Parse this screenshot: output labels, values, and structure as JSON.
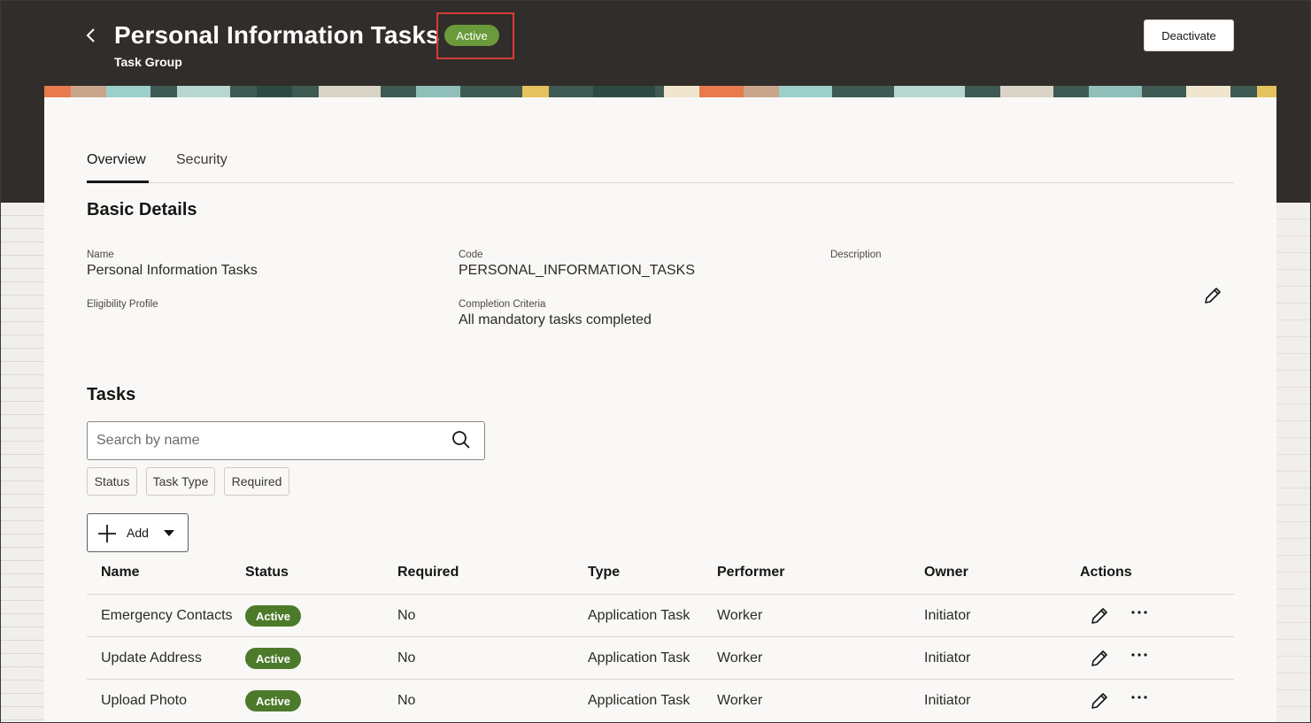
{
  "header": {
    "title": "Personal Information Tasks",
    "subtitle": "Task Group",
    "status_badge": "Active",
    "deactivate_label": "Deactivate"
  },
  "tabs": [
    {
      "label": "Overview",
      "active": true
    },
    {
      "label": "Security",
      "active": false
    }
  ],
  "basic_details": {
    "title": "Basic Details",
    "name_label": "Name",
    "name_value": "Personal Information Tasks",
    "code_label": "Code",
    "code_value": "PERSONAL_INFORMATION_TASKS",
    "description_label": "Description",
    "eligibility_label": "Eligibility Profile",
    "completion_label": "Completion Criteria",
    "completion_value": "All mandatory tasks completed"
  },
  "tasks": {
    "title": "Tasks",
    "search_placeholder": "Search by name",
    "filters": [
      "Status",
      "Task Type",
      "Required"
    ],
    "add_label": "Add",
    "columns": [
      "Name",
      "Status",
      "Required",
      "Type",
      "Performer",
      "Owner",
      "Actions"
    ],
    "rows": [
      {
        "name": "Emergency Contacts",
        "status": "Active",
        "required": "No",
        "type": "Application Task",
        "performer": "Worker",
        "owner": "Initiator"
      },
      {
        "name": "Update Address",
        "status": "Active",
        "required": "No",
        "type": "Application Task",
        "performer": "Worker",
        "owner": "Initiator"
      },
      {
        "name": "Upload Photo",
        "status": "Active",
        "required": "No",
        "type": "Application Task",
        "performer": "Worker",
        "owner": "Initiator"
      }
    ]
  },
  "colors": {
    "header_bg": "#312d2a",
    "badge_green": "#6a9a3a",
    "row_badge_green": "#4c7a2b",
    "highlight_red": "#d63b3b"
  },
  "icons": {
    "back": "chevron-left-icon",
    "edit": "pencil-icon",
    "search": "search-icon",
    "add": "plus-icon",
    "dropdown": "caret-down-icon",
    "more": "ellipsis-icon"
  }
}
